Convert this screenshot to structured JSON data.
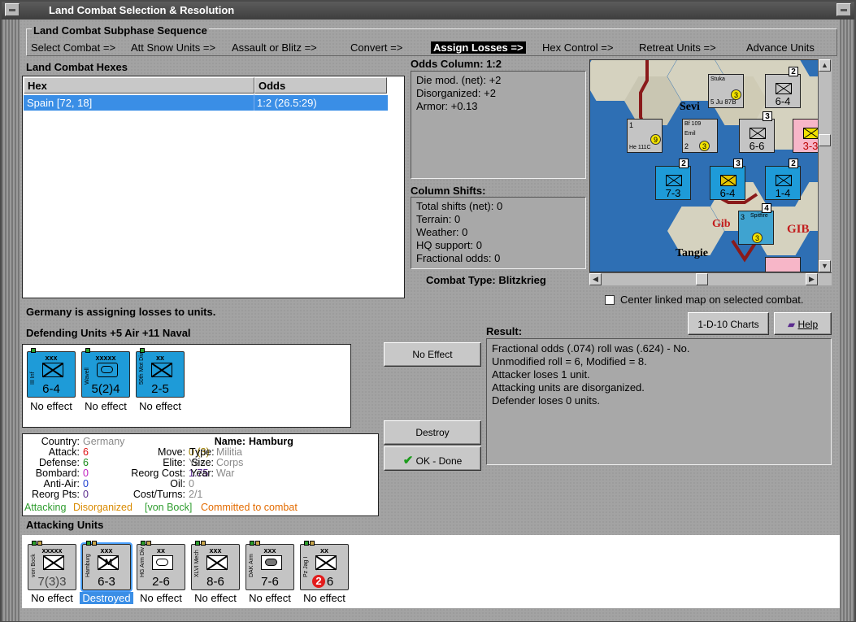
{
  "window": {
    "title": "Land Combat Selection & Resolution"
  },
  "subphase": {
    "header": "Land Combat Subphase Sequence",
    "steps": [
      "Select Combat =>",
      "Att Snow Units =>",
      "Assault or Blitz =>",
      "Convert =>",
      "Assign Losses =>",
      "Hex Control =>",
      "Retreat Units =>",
      "Advance Units"
    ]
  },
  "hexes": {
    "title": "Land Combat Hexes",
    "col_hex": "Hex",
    "col_odds": "Odds",
    "rows": [
      {
        "hex": "Spain [72, 18]",
        "odds": "1:2 (26.5:29)"
      }
    ]
  },
  "odds": {
    "title": "Odds Column: 1:2",
    "lines": [
      "Die mod. (net): +2",
      "Disorganized: +2",
      "Armor: +0.13"
    ]
  },
  "shifts": {
    "title": "Column Shifts:",
    "lines": [
      "Total shifts (net): 0",
      "Terrain: 0",
      "Weather: 0",
      "HQ support: 0",
      "Fractional odds: 0"
    ]
  },
  "combat_type": "Combat Type:  Blitzkrieg",
  "center_map_label": "Center linked map on selected combat.",
  "status_text": "Germany is assigning losses to units.",
  "defending": {
    "title": "Defending Units +5 Air +11 Naval",
    "units": [
      {
        "name": "III Inf",
        "size": "xxx",
        "stats": "6-4",
        "effect": "No effect"
      },
      {
        "name": "Wavell",
        "size": "xxxxx",
        "stats": "5(2)4",
        "effect": "No effect"
      },
      {
        "name": "50th Mot Div",
        "size": "xx",
        "stats": "2-5",
        "effect": "No effect"
      }
    ]
  },
  "buttons": {
    "no_effect": "No Effect",
    "destroy": "Destroy",
    "ok_done": "OK - Done",
    "charts": "1-D-10 Charts",
    "help": "Help"
  },
  "result": {
    "title": "Result:",
    "lines": [
      "Fractional odds (.074) roll was (.624)  - No.",
      "Unmodified roll = 6, Modified = 8.",
      "Attacker loses 1 unit.",
      "Attacking units are disorganized.",
      "Defender loses 0 units."
    ]
  },
  "detail": {
    "country_k": "Country:",
    "country_v": "Germany",
    "attack_k": "Attack:",
    "attack_v": "6",
    "defense_k": "Defense:",
    "defense_v": "6",
    "bombard_k": "Bombard:",
    "bombard_v": "0",
    "antiair_k": "Anti-Air:",
    "antiair_v": "0",
    "reorg_pts_k": "Reorg Pts:",
    "reorg_pts_v": "0",
    "name_k": "Name:",
    "name_v": "Hamburg",
    "move_k": "Move:",
    "move_v": "0 (3)",
    "elite_k": "Elite:",
    "elite_v": "Yes",
    "reorg_cost_k": "Reorg Cost:",
    "reorg_cost_v": "1.75",
    "oil_k": "Oil:",
    "oil_v": "0",
    "cost_turns_k": "Cost/Turns:",
    "cost_turns_v": "2/1",
    "type_k": "Type:",
    "type_v": "Militia",
    "size_k": "Size:",
    "size_v": "Corps",
    "year_k": "Year:",
    "year_v": "War",
    "status_attacking": "Attacking",
    "status_disorg": "Disorganized",
    "status_hq": "[von Bock]",
    "status_committed": "Committed to combat"
  },
  "attacking": {
    "title": "Attacking Units",
    "units": [
      {
        "name": "von Bock",
        "size": "xxxxx",
        "stats": "7(3)3",
        "effect": "No effect"
      },
      {
        "name": "Hamburg",
        "size": "xxx",
        "stats": "6-3",
        "effect": "Destroyed",
        "selected": true
      },
      {
        "name": "HG Arm Div",
        "size": "xx",
        "stats": "2-6",
        "effect": "No effect"
      },
      {
        "name": "XLVI Mech",
        "size": "xxx",
        "stats": "8-6",
        "effect": "No effect"
      },
      {
        "name": "DAK Arm",
        "size": "xxx",
        "stats": "7-6",
        "effect": "No effect"
      },
      {
        "name": "Pz Jag I",
        "size": "xx",
        "stats": "6",
        "badge": "2",
        "effect": "No effect"
      }
    ]
  },
  "map": {
    "labels": {
      "sevilla": "Sevi",
      "gib": "Gib",
      "gib2": "GIB",
      "tangier": "Tangie"
    },
    "counters": [
      {
        "stats": "6-4",
        "num": "2"
      },
      {
        "stats": "7-3",
        "num": "2"
      },
      {
        "stats": "6-4",
        "num": "3"
      },
      {
        "stats": "1-4",
        "num": "2"
      },
      {
        "stats": "6-6",
        "num": "3"
      },
      {
        "stats": "3-3",
        "num": ""
      },
      {
        "stats": "",
        "num": "4"
      }
    ],
    "air_labels": [
      "Stuka",
      "5 Ju 87B",
      "Bf 109",
      "Emil",
      "He 111C",
      "Spitfire"
    ],
    "air_small": [
      "1",
      "2",
      "5",
      "2",
      "3"
    ],
    "yellow": [
      "3",
      "9",
      "3",
      "3"
    ]
  },
  "colors": {
    "selected_blue": "#3a8ee6",
    "attacking_green": "#2e9c2e",
    "disorganized_orange": "#d98a00",
    "committed_orange": "#e36b00"
  }
}
